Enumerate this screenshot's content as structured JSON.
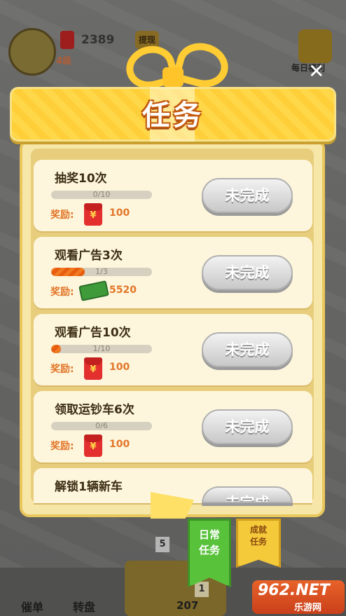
{
  "hud": {
    "coin_count": "2389",
    "level": "4级",
    "withdraw_label": "提现",
    "daily_label": "每日福利",
    "close_symbol": "✕"
  },
  "bottom_nav": {
    "hotline_label": "催单",
    "wheel_label": "转盘",
    "vehicle_count": "207",
    "slot_level_1": "5",
    "slot_level_2": "1"
  },
  "modal": {
    "title": "任务",
    "tasks": [
      {
        "name": "抽奖10次",
        "progress_text": "0/10",
        "progress": 0.0,
        "reward_label": "奖励:",
        "reward_icon": "red-envelope-icon",
        "reward_value": "100",
        "button_label": "未完成"
      },
      {
        "name": "观看广告3次",
        "progress_text": "1/3",
        "progress": 0.333,
        "reward_label": "奖励:",
        "reward_icon": "cash-icon",
        "reward_value": "5520",
        "button_label": "未完成"
      },
      {
        "name": "观看广告10次",
        "progress_text": "1/10",
        "progress": 0.1,
        "reward_label": "奖励:",
        "reward_icon": "red-envelope-icon",
        "reward_value": "100",
        "button_label": "未完成"
      },
      {
        "name": "领取运钞车6次",
        "progress_text": "0/6",
        "progress": 0.0,
        "reward_label": "奖励:",
        "reward_icon": "red-envelope-icon",
        "reward_value": "100",
        "button_label": "未完成"
      },
      {
        "name": "解锁1辆新车",
        "button_label": "未完成"
      }
    ],
    "tab_daily": "日常\n任务",
    "tab_achievement": "成就\n任务"
  },
  "watermark": {
    "top": "962.NET",
    "bottom": "乐游网"
  },
  "colors": {
    "accent_orange": "#e2762a",
    "banner_yellow": "#ffd84a",
    "tab_green": "#58c23a"
  }
}
